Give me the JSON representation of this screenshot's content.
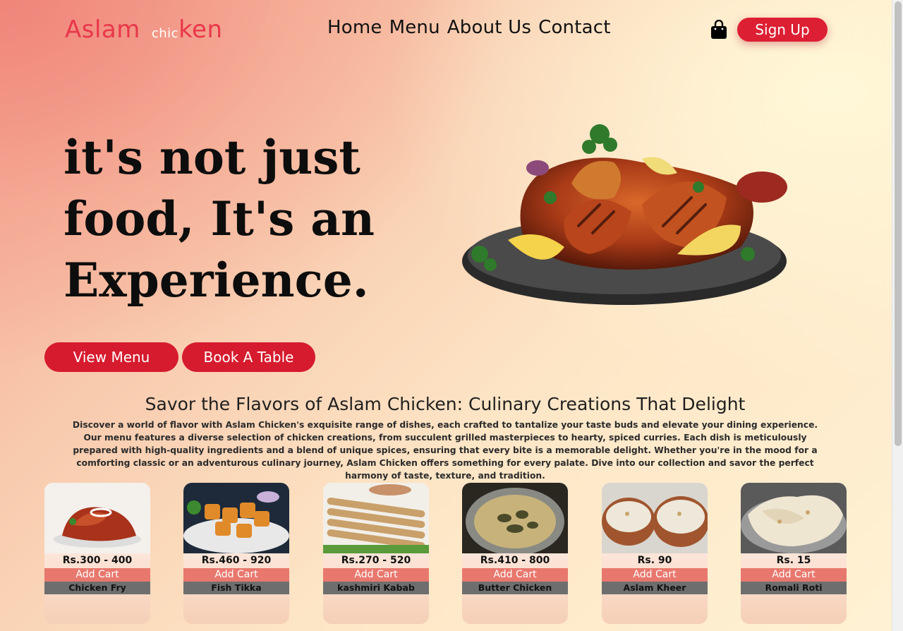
{
  "brand": {
    "logo_part1": "Aslam",
    "logo_part2": "chic",
    "logo_part3": "ken",
    "color": "#e8374a"
  },
  "nav": {
    "items": [
      "Home",
      "Menu",
      "About Us",
      "Contact"
    ]
  },
  "header": {
    "cart_icon": "shopping-bag-icon",
    "signup_label": "Sign Up"
  },
  "hero": {
    "line1": "it's not just",
    "line2": "food, It's an",
    "line3": "Experience.",
    "view_menu_label": "View Menu",
    "book_table_label": "Book A Table"
  },
  "section": {
    "title": "Savor the Flavors of Aslam Chicken: Culinary Creations That Delight",
    "description": "Discover a world of flavor with Aslam Chicken's exquisite range of dishes, each crafted to tantalize your taste buds and elevate your dining experience. Our menu features a diverse selection of chicken creations, from succulent grilled masterpieces to hearty, spiced curries. Each dish is meticulously prepared with high-quality ingredients and a blend of unique spices, ensuring that every bite is a memorable delight. Whether you're in the mood for a comforting classic or an adventurous culinary journey, Aslam Chicken offers something for every palate. Dive into our collection and savor the perfect harmony of taste, texture, and tradition."
  },
  "menu_items": [
    {
      "price": "Rs.300 - 400",
      "cart_label": "Add Cart",
      "name": "Chicken Fry"
    },
    {
      "price": "Rs.460 - 920",
      "cart_label": "Add Cart",
      "name": "Fish Tikka"
    },
    {
      "price": "Rs.270 - 520",
      "cart_label": "Add Cart",
      "name": "kashmiri Kabab"
    },
    {
      "price": "Rs.410 - 800",
      "cart_label": "Add Cart",
      "name": "Butter Chicken"
    },
    {
      "price": "Rs. 90",
      "cart_label": "Add Cart",
      "name": "Aslam Kheer"
    },
    {
      "price": "Rs. 15",
      "cart_label": "Add Cart",
      "name": "Romali Roti"
    }
  ],
  "colors": {
    "accent": "#d61b2e",
    "cart_bar": "#e8786e",
    "name_bar": "#6e6e6e"
  }
}
